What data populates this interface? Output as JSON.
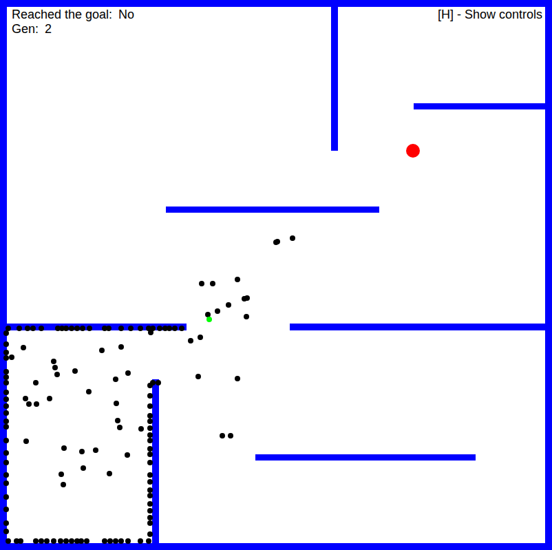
{
  "hud": {
    "goal_label": "Reached the goal:",
    "goal_value": "No",
    "gen_label": "Gen:",
    "gen_value": "2"
  },
  "controls_hint": "[H] - Show controls"
}
